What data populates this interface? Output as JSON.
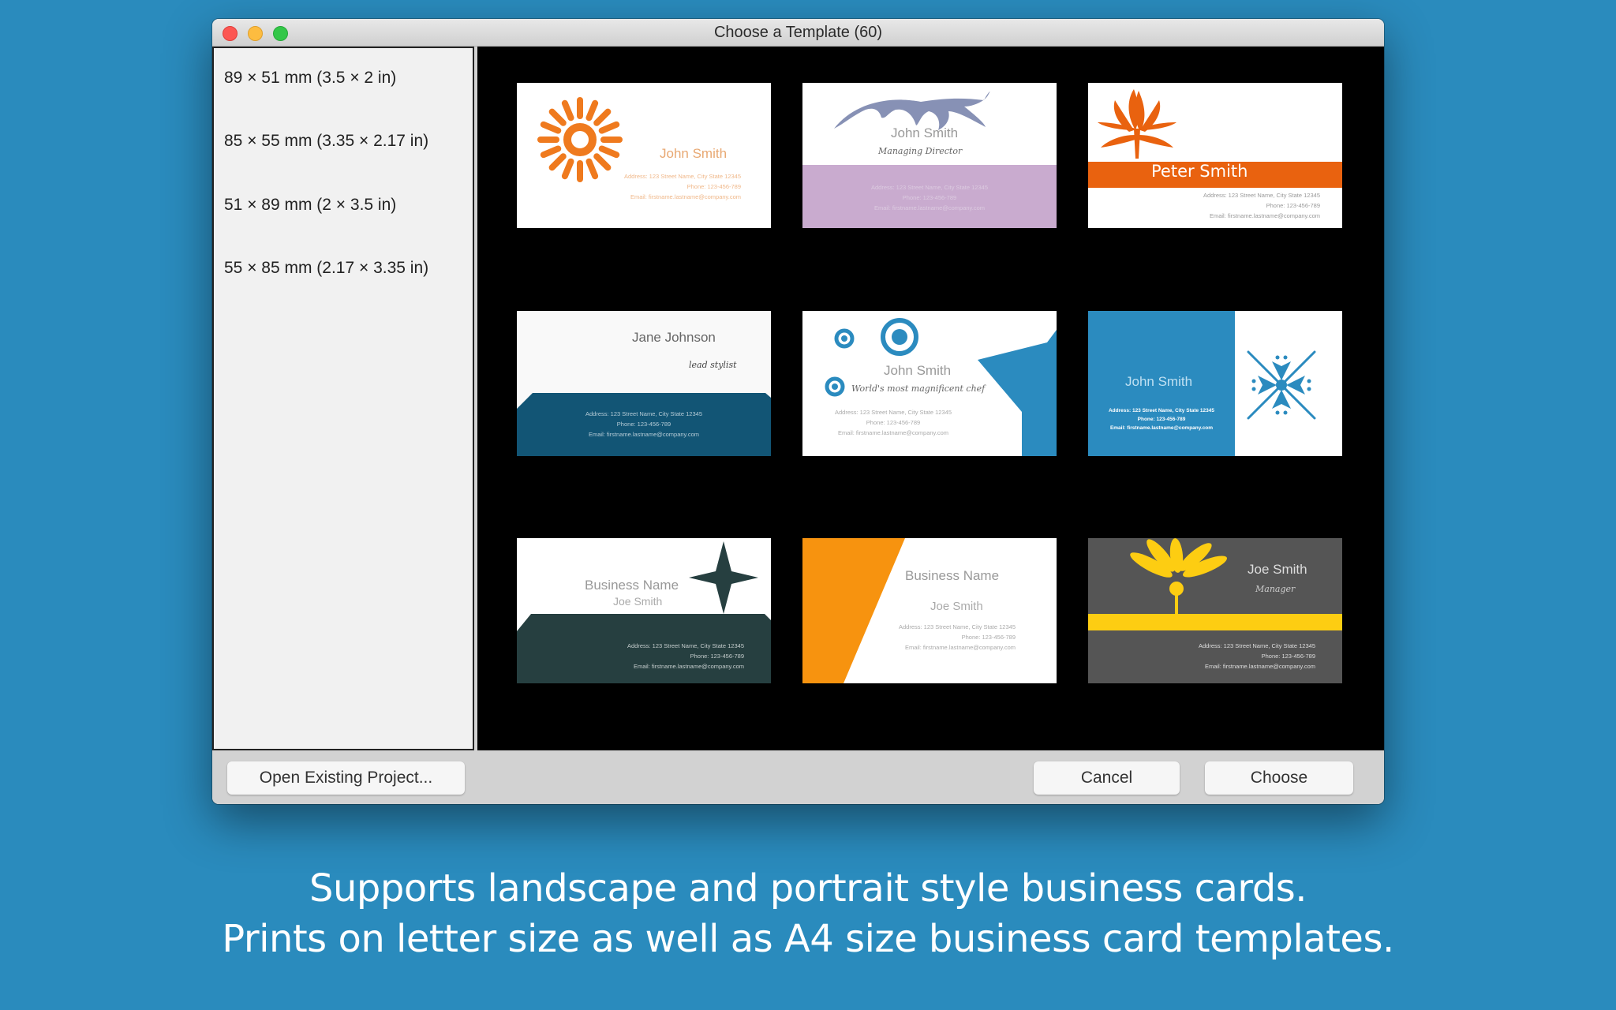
{
  "window": {
    "title": "Choose a Template (60)",
    "traffic_lights": [
      "close",
      "minimize",
      "zoom"
    ]
  },
  "sidebar": {
    "items": [
      {
        "label": "89 × 51 mm (3.5 × 2 in)"
      },
      {
        "label": "85 × 55 mm (3.35 × 2.17 in)"
      },
      {
        "label": "51 × 89 mm (2 × 3.5 in)"
      },
      {
        "label": "55 × 85 mm (2.17 × 3.35 in)"
      }
    ]
  },
  "templates": [
    {
      "name": "John Smith",
      "title": "",
      "address": "Address:  123 Street Name, City State 12345",
      "phone": "Phone: 123-456-789",
      "email": "Email: firstname.lastname@company.com",
      "icon": "sun-icon",
      "accent": "#ef7a1e"
    },
    {
      "name": "John Smith",
      "title": "Managing Director",
      "address": "Address:  123 Street Name, City State 12345",
      "phone": "Phone: 123-456-789",
      "email": "Email: firstname.lastname@company.com",
      "icon": "leaf-icon",
      "accent": "#c9abcf"
    },
    {
      "name": "Peter Smith",
      "title": "",
      "address": "Address:  123 Street Name, City State 12345",
      "phone": "Phone: 123-456-789",
      "email": "Email: firstname.lastname@company.com",
      "icon": "lotus-icon",
      "accent": "#e9620f"
    },
    {
      "name": "Jane Johnson",
      "title": "lead stylist",
      "address": "Address:  123 Street Name, City State 12345",
      "phone": "Phone: 123-456-789",
      "email": "Email: firstname.lastname@company.com",
      "icon": "",
      "accent": "#125575"
    },
    {
      "name": "John Smith",
      "title": "World's most magnificent chef",
      "address": "Address:  123 Street Name, City State 12345",
      "phone": "Phone: 123-456-789",
      "email": "Email: firstname.lastname@company.com",
      "icon": "circles-icon",
      "accent": "#2b8bbf"
    },
    {
      "name": "John Smith",
      "title": "",
      "address": "Address:  123 Street Name, City State 12345",
      "phone": "Phone: 123-456-789",
      "email": "Email: firstname.lastname@company.com",
      "icon": "snowflake-icon",
      "accent": "#2b8bbf"
    },
    {
      "name": "Business Name",
      "title": "Joe Smith",
      "address": "Address:  123 Street Name, City State 12345",
      "phone": "Phone: 123-456-789",
      "email": "Email: firstname.lastname@company.com",
      "icon": "star-icon",
      "accent": "#263f40"
    },
    {
      "name": "Business Name",
      "title": "Joe Smith",
      "address": "Address:  123 Street Name, City State 12345",
      "phone": "Phone: 123-456-789",
      "email": "Email: firstname.lastname@company.com",
      "icon": "",
      "accent": "#f7930f"
    },
    {
      "name": "Joe Smith",
      "title": "Manager",
      "address": "Address:  123 Street Name, City State 12345",
      "phone": "Phone: 123-456-789",
      "email": "Email: firstname.lastname@company.com",
      "icon": "flower-icon",
      "accent": "#fdcd12"
    }
  ],
  "footer": {
    "open_label": "Open Existing Project...",
    "cancel_label": "Cancel",
    "choose_label": "Choose"
  },
  "caption": {
    "line1": "Supports landscape and portrait style business cards.",
    "line2": "Prints on letter size as well as A4 size business card templates."
  }
}
